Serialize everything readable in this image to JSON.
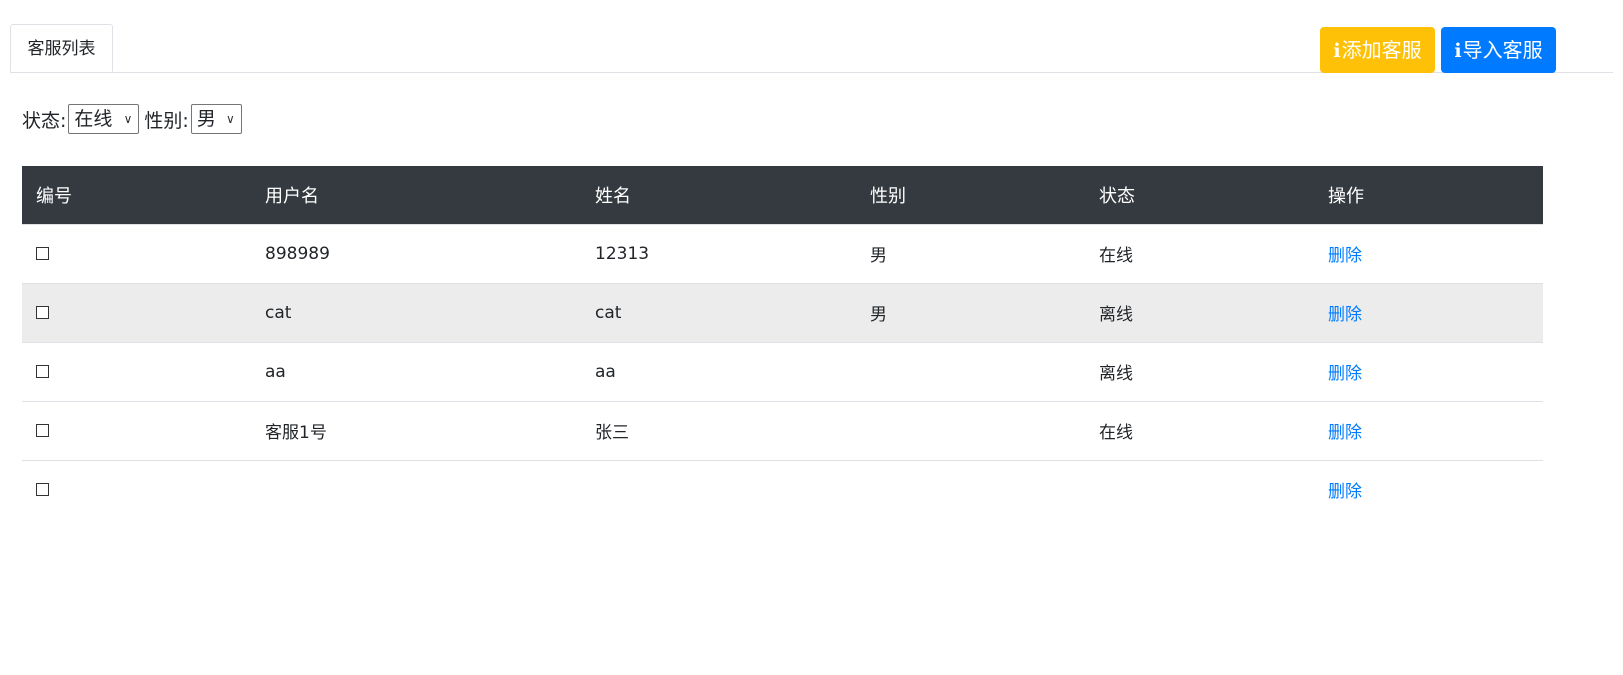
{
  "tabs": [
    {
      "label": "客服列表"
    }
  ],
  "toolbar": {
    "add_label": "添加客服",
    "import_label": "导入客服",
    "info_glyph": "i"
  },
  "filters": {
    "status_label": "状态:",
    "status_value": "在线",
    "gender_label": "性别:",
    "gender_value": "男"
  },
  "table": {
    "headers": [
      "编号",
      "用户名",
      "姓名",
      "性别",
      "状态",
      "操作"
    ],
    "rows": [
      {
        "username": "898989",
        "name": "12313",
        "gender": "男",
        "status": "在线",
        "action": "删除"
      },
      {
        "username": "cat",
        "name": "cat",
        "gender": "男",
        "status": "离线",
        "action": "删除"
      },
      {
        "username": "aa",
        "name": "aa",
        "gender": "",
        "status": "离线",
        "action": "删除"
      },
      {
        "username": "客服1号",
        "name": "张三",
        "gender": "",
        "status": "在线",
        "action": "删除"
      },
      {
        "username": "",
        "name": "",
        "gender": "",
        "status": "",
        "action": "删除"
      }
    ]
  },
  "colors": {
    "add_button": "#ffc107",
    "import_button": "#007bff",
    "table_header": "#343a40",
    "link": "#007bff"
  }
}
